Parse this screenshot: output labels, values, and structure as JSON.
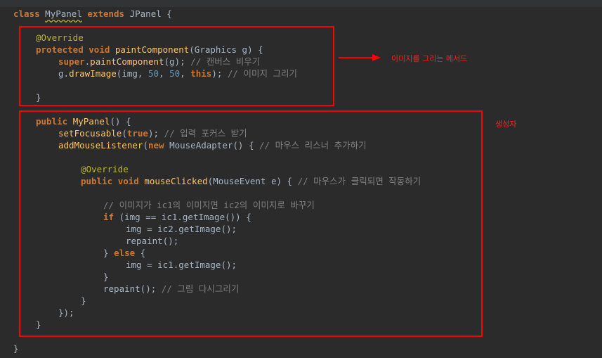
{
  "code": {
    "line1": {
      "kw1": "class",
      "name": "MyPanel",
      "kw2": "extends",
      "parent": "JPanel",
      "brace": "{"
    },
    "line2": {
      "ann": "@Override"
    },
    "line3": {
      "kw1": "protected",
      "kw2": "void",
      "fn": "paintComponent",
      "p1": "(",
      "type": "Graphics",
      "param": "g",
      "p2": ") {"
    },
    "line4": {
      "kw": "super",
      "rest1": ".",
      "fn": "paintComponent",
      "rest2": "(g);",
      "cmt": "// 캔버스 비우기"
    },
    "line5": {
      "obj": "g.",
      "fn": "drawImage",
      "a1": "(img, ",
      "n1": "50",
      "a2": ", ",
      "n2": "50",
      "a3": ", ",
      "kw": "this",
      "a4": ");",
      "cmt": "// 이미지 그리기"
    },
    "line6": {
      "brace": "}"
    },
    "line7": {
      "kw": "public",
      "fn": "MyPanel",
      "rest": "() {"
    },
    "line8": {
      "fn": "setFocusable",
      "p1": "(",
      "kw": "true",
      "p2": ");",
      "cmt": "// 입력 포커스 받기"
    },
    "line9": {
      "fn": "addMouseListener",
      "p1": "(",
      "kw": "new",
      "cls": "MouseAdapter() {",
      "cmt": "// 마우스 리스너 추가하기"
    },
    "line10": {
      "ann": "@Override"
    },
    "line11": {
      "kw1": "public",
      "kw2": "void",
      "fn": "mouseClicked",
      "p1": "(",
      "type": "MouseEvent",
      "param": "e",
      "p2": ") {",
      "cmt": "// 마우스가 클릭되면 작동하기"
    },
    "line12": {
      "cmt": "// 이미지가 ic1의 이미지면 ic2의 이미지로 바꾸기"
    },
    "line13": {
      "kw": "if",
      "rest": "(img == ic1.getImage()) {"
    },
    "line14": {
      "text": "img = ic2.getImage();"
    },
    "line15": {
      "text": "repaint();"
    },
    "line16": {
      "p1": "}",
      "kw": "else",
      "p2": "{"
    },
    "line17": {
      "text": "img = ic1.getImage();"
    },
    "line18": {
      "text": "}"
    },
    "line19": {
      "text": "repaint();",
      "cmt": "// 그림 다시그리기"
    },
    "line20": {
      "text": "}"
    },
    "line21": {
      "text": "});"
    },
    "line22": {
      "text": "}"
    },
    "line23": {
      "text": "}"
    }
  },
  "annotations": {
    "paint_method_note": "이미지를 그리는 메서드",
    "constructor_note": "생성자",
    "color": "#ff0000"
  }
}
